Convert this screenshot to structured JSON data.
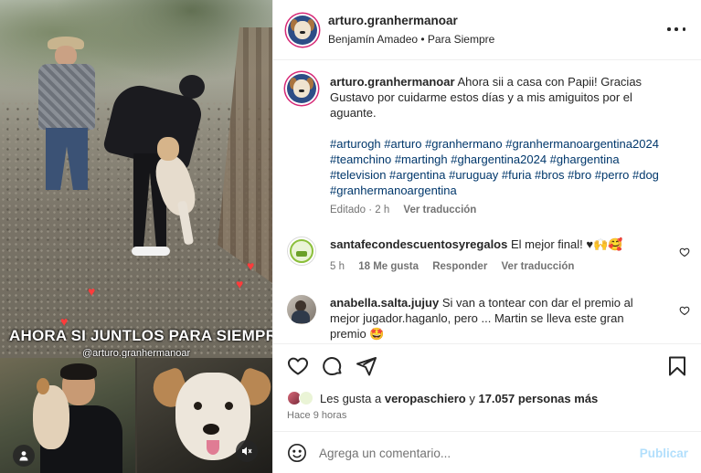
{
  "media": {
    "overlay_text_main": "AHORA SI JUNTLOS PARA SIEMPRE",
    "overlay_text_heart": "❤",
    "overlay_handle": "@arturo.granhermanoar",
    "heart_glyph": "♥",
    "accent_heart_color": "#ff3b3b"
  },
  "header": {
    "username": "arturo.granhermanoar",
    "subtitle": "Benjamín Amadeo • Para Siempre"
  },
  "caption": {
    "username": "arturo.granhermanoar",
    "text": "Ahora sii a casa con Papii! Gracias Gustavo por cuidarme estos días y a mis amiguitos por el aguante.",
    "hashtags": "#arturogh #arturo #granhermano #granhermanoargentina2024 #teamchino #martingh #ghargentina2024 #ghargentina #television #argentina #uruguay #furia #bros #bro #perro #dog #granhermanoargentina",
    "edited": "Editado · 2 h",
    "see_translation": "Ver traducción"
  },
  "comments": [
    {
      "username": "santafecondescuentosyregalos",
      "text": "El mejor final! ♥🙌🥰",
      "time": "5 h",
      "likes": "18 Me gusta",
      "reply": "Responder",
      "see_translation": "Ver traducción"
    },
    {
      "username": "anabella.salta.jujuy",
      "text": "Si van a tontear con dar el premio al mejor jugador.haganlo, pero ... Martin se lleva este gran premio 🤩"
    }
  ],
  "likes": {
    "prefix": "Les gusta a",
    "user": "veropaschiero",
    "connector": "y",
    "count": "17.057 personas más"
  },
  "posted_time": "Hace 9 horas",
  "composer": {
    "placeholder": "Agrega un comentario...",
    "publish_label": "Publicar"
  },
  "colors": {
    "link": "#00376b",
    "muted": "#737373",
    "publish_disabled": "#b2dffc",
    "story_ring": "#d62976"
  }
}
